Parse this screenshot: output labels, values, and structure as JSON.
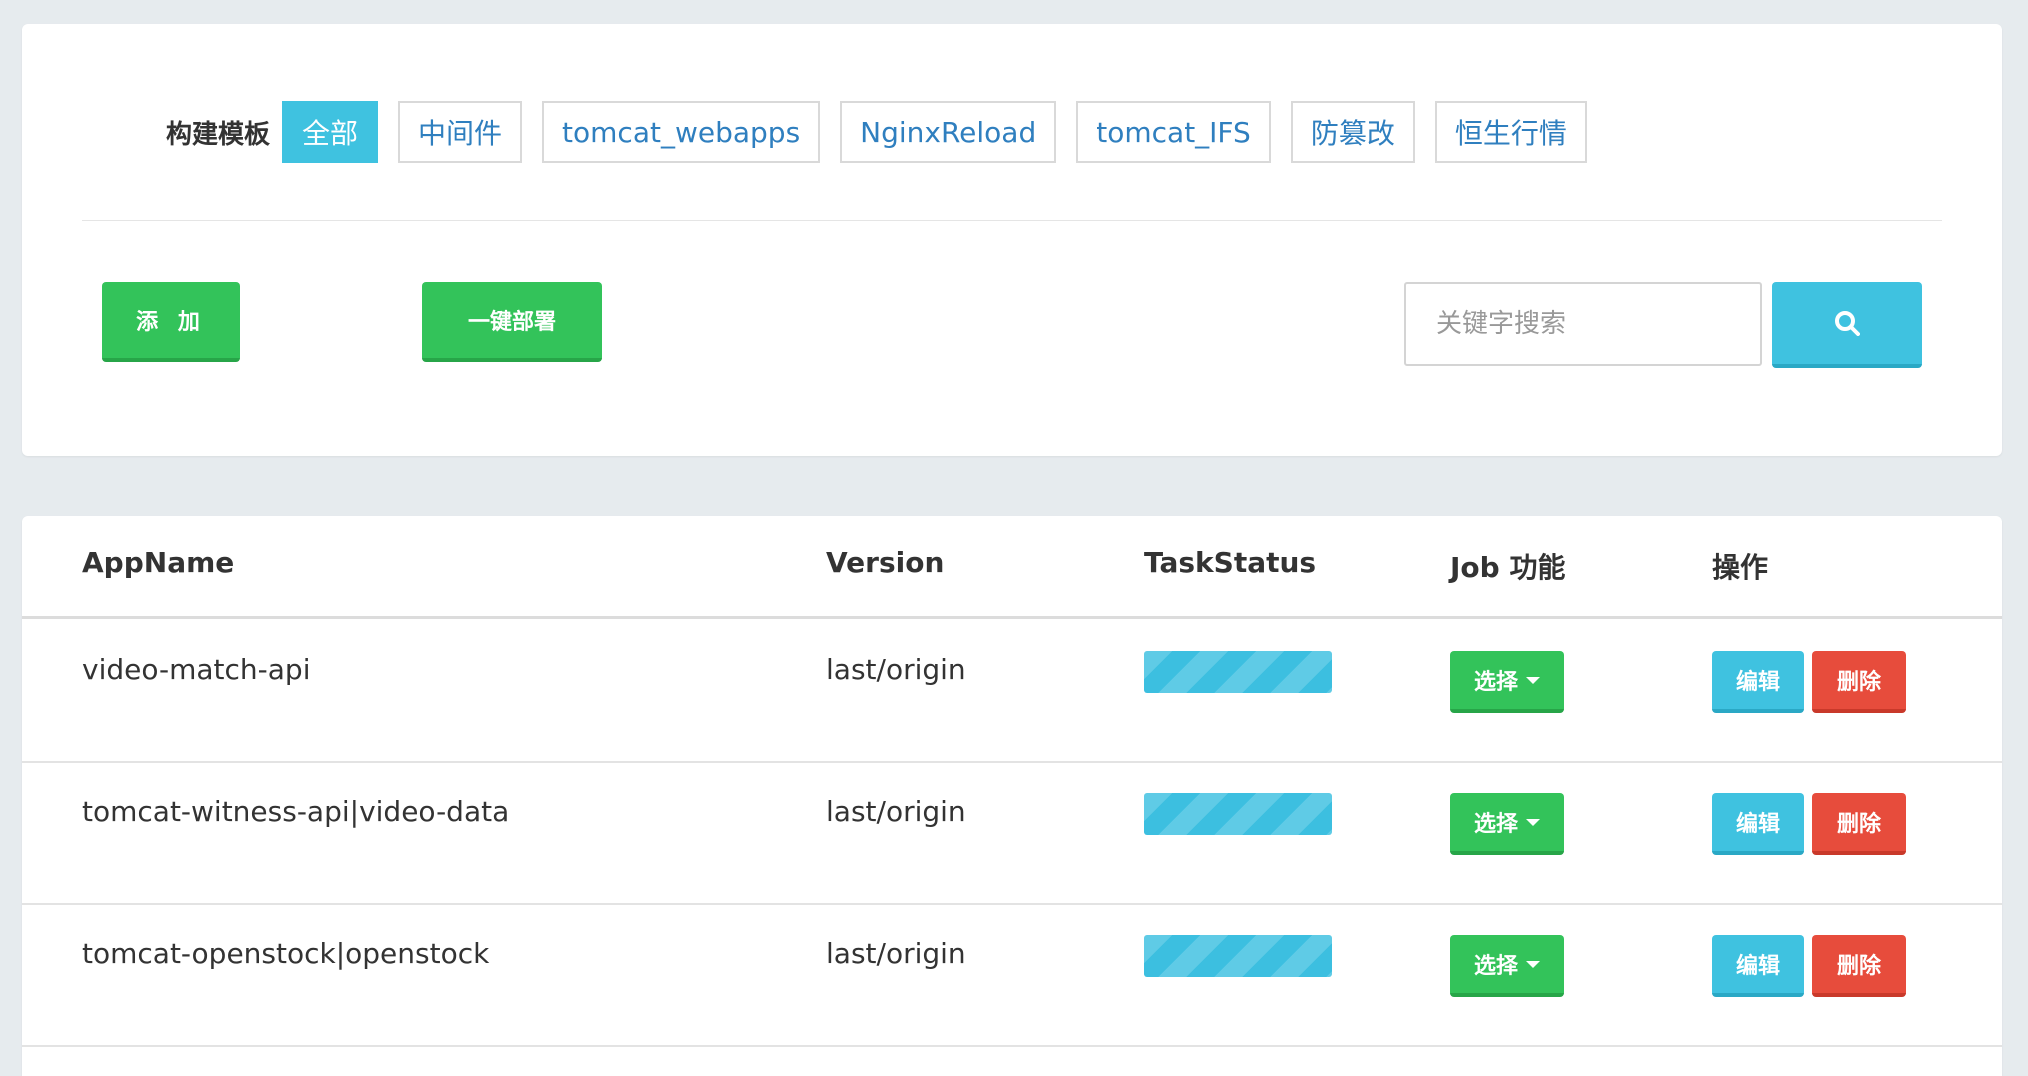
{
  "filters": {
    "label": "构建模板",
    "templates": [
      {
        "label": "全部",
        "active": true
      },
      {
        "label": "中间件",
        "active": false
      },
      {
        "label": "tomcat_webapps",
        "active": false
      },
      {
        "label": "NginxReload",
        "active": false
      },
      {
        "label": "tomcat_IFS",
        "active": false
      },
      {
        "label": "防篡改",
        "active": false
      },
      {
        "label": "恒生行情",
        "active": false
      }
    ],
    "add_label": "添 加",
    "deploy_label": "一键部署",
    "search_placeholder": "关键字搜索",
    "search_value": ""
  },
  "table": {
    "headers": {
      "app_name": "AppName",
      "version": "Version",
      "task_status": "TaskStatus",
      "job": "Job 功能",
      "ops": "操作"
    },
    "rows": [
      {
        "app_name": "video-match-api",
        "version": "last/origin",
        "progress": 1.0,
        "select_label": "选择",
        "edit_label": "编辑",
        "delete_label": "删除"
      },
      {
        "app_name": "tomcat-witness-api|video-data",
        "version": "last/origin",
        "progress": 1.0,
        "select_label": "选择",
        "edit_label": "编辑",
        "delete_label": "删除"
      },
      {
        "app_name": "tomcat-openstock|openstock",
        "version": "last/origin",
        "progress": 1.0,
        "select_label": "选择",
        "edit_label": "编辑",
        "delete_label": "删除"
      }
    ]
  },
  "colors": {
    "accent_cyan": "#3fc2e0",
    "green": "#33c35a",
    "red": "#e74c3c",
    "link_blue": "#2f7fbf"
  },
  "icons": {
    "search": "search-icon",
    "caret": "caret-down-icon"
  }
}
